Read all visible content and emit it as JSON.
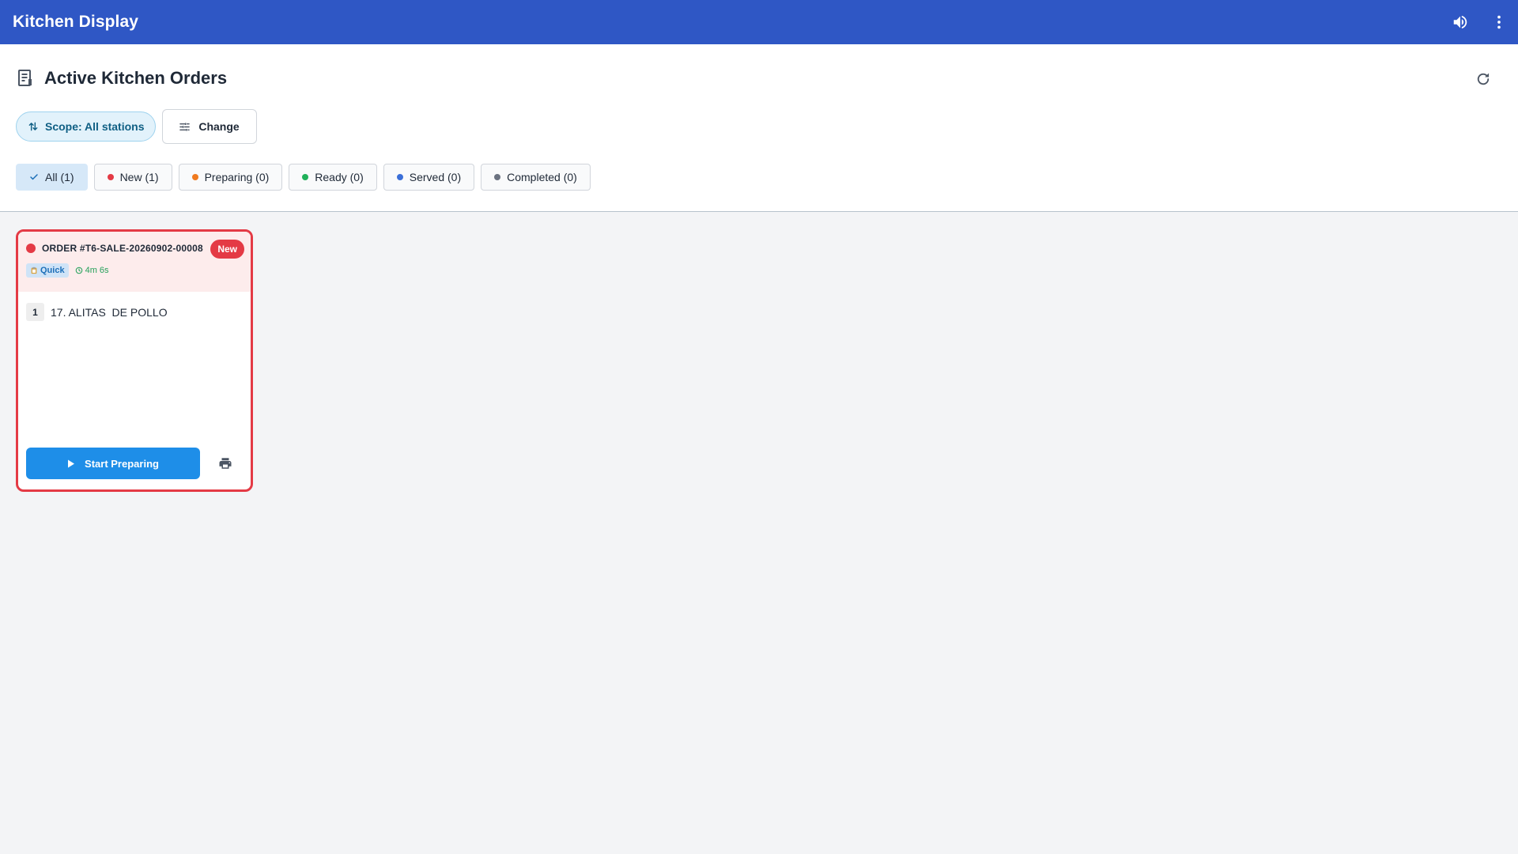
{
  "appbar": {
    "title": "Kitchen Display",
    "icons": {
      "sound": "volume-up-icon",
      "menu": "more-vertical-icon"
    },
    "color": "#2f57c5"
  },
  "header": {
    "title": "Active Kitchen Orders",
    "title_icon": "receipt-icon",
    "refresh_icon": "refresh-icon",
    "scope_label": "Scope: All stations",
    "change_label": "Change"
  },
  "filters": [
    {
      "label": "All (1)",
      "active": true,
      "icon": "check-icon"
    },
    {
      "label": "New (1)",
      "color": "#e43a45"
    },
    {
      "label": "Preparing (0)",
      "color": "#f07a1f"
    },
    {
      "label": "Ready (0)",
      "color": "#20b15a"
    },
    {
      "label": "Served (0)",
      "color": "#3b6fd8"
    },
    {
      "label": "Completed (0)",
      "color": "#6b7280"
    }
  ],
  "orders": [
    {
      "order_no": "ORDER #T6-SALE-20260902-00008",
      "status": "New",
      "type_tag": "Quick",
      "elapsed": "4m 6s",
      "items": [
        {
          "qty": "1",
          "name": "17. ALITAS  DE POLLO"
        }
      ],
      "action_label": "Start Preparing",
      "status_color": "#e43a45"
    }
  ]
}
